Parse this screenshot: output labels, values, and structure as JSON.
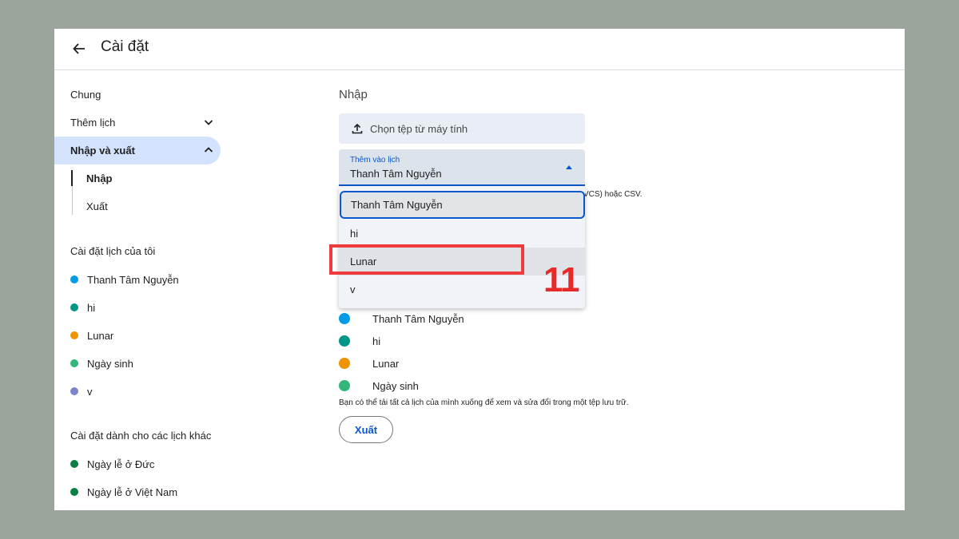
{
  "header": {
    "title": "Cài đặt"
  },
  "sidebar": {
    "general": "Chung",
    "add_calendar": "Thêm lịch",
    "import_export": "Nhập và xuất",
    "sub_import": "Nhập",
    "sub_export": "Xuất",
    "my_calendars_title": "Cài đặt lịch của tôi",
    "my_calendars": [
      {
        "name": "Thanh Tâm Nguyễn",
        "color": "#039be5"
      },
      {
        "name": "hi",
        "color": "#009688"
      },
      {
        "name": "Lunar",
        "color": "#f09300"
      },
      {
        "name": "Ngày sinh",
        "color": "#33b679"
      },
      {
        "name": "v",
        "color": "#7986cb"
      }
    ],
    "other_calendars_title": "Cài đặt dành cho các lịch khác",
    "other_calendars": [
      {
        "name": "Ngày lễ ở Đức",
        "color": "#0b8043"
      },
      {
        "name": "Ngày lễ ở Việt Nam",
        "color": "#0b8043"
      }
    ]
  },
  "main": {
    "title": "Nhập",
    "upload_label": "Chọn tệp từ máy tính",
    "select": {
      "label": "Thêm vào lịch",
      "value": "Thanh Tâm Nguyễn"
    },
    "hint_tail": "VCS) hoặc CSV.",
    "dropdown_options": [
      "Thanh Tâm Nguyễn",
      "hi",
      "Lunar",
      "v"
    ],
    "annotation_number": "11",
    "export_list": [
      {
        "name": "Thanh Tâm Nguyễn",
        "color": "#039be5"
      },
      {
        "name": "hi",
        "color": "#009688"
      },
      {
        "name": "Lunar",
        "color": "#f09300"
      },
      {
        "name": "Ngày sinh",
        "color": "#33b679"
      }
    ],
    "export_note": "Bạn có thể tải tất cả lịch của mình xuống để xem và sửa đổi trong một tệp lưu trữ.",
    "export_button": "Xuất"
  }
}
